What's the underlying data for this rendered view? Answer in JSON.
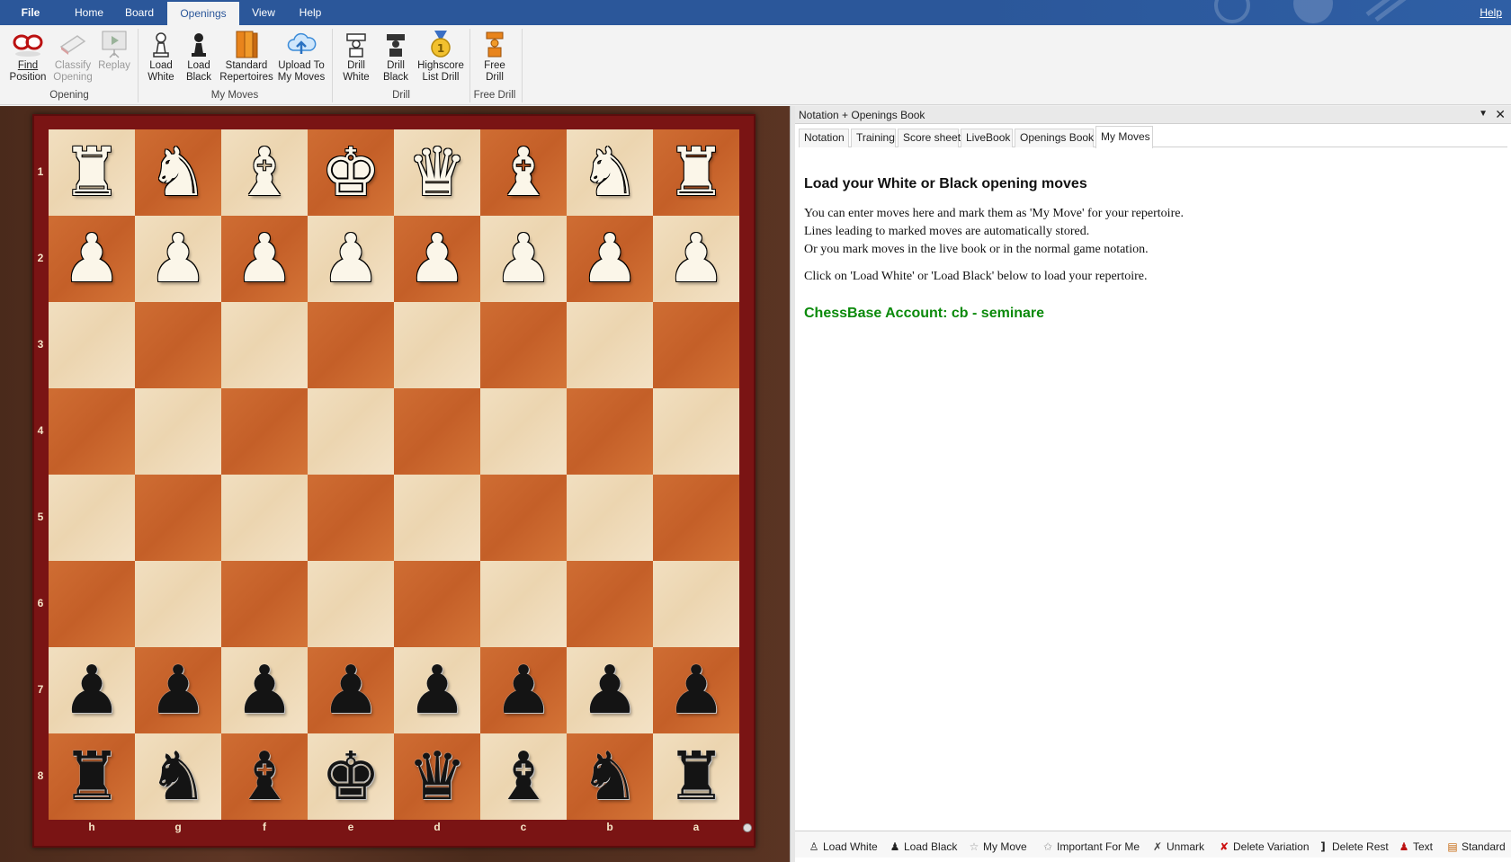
{
  "ribbon_tabs": [
    {
      "label": "File"
    },
    {
      "label": "Home"
    },
    {
      "label": "Board"
    },
    {
      "label": "Openings",
      "active": true
    },
    {
      "label": "View"
    },
    {
      "label": "Help"
    }
  ],
  "help_link": "Help",
  "ribbon": {
    "buttons": [
      {
        "label1": "Find",
        "label2": "Position",
        "icon": "find-position-icon"
      },
      {
        "label1": "Classify",
        "label2": "Opening",
        "icon": "classify-opening-icon",
        "disabled": true
      },
      {
        "label1": "Replay",
        "label2": "",
        "icon": "replay-icon",
        "disabled": true
      },
      {
        "label1": "Load",
        "label2": "White",
        "icon": "white-pawn-icon"
      },
      {
        "label1": "Load",
        "label2": "Black",
        "icon": "black-pawn-icon"
      },
      {
        "label1": "Standard",
        "label2": "Repertoires",
        "icon": "books-icon"
      },
      {
        "label1": "Upload To",
        "label2": "My Moves",
        "icon": "cloud-upload-icon"
      },
      {
        "label1": "Drill",
        "label2": "White",
        "icon": "drill-white-icon"
      },
      {
        "label1": "Drill",
        "label2": "Black",
        "icon": "drill-black-icon"
      },
      {
        "label1": "Highscore",
        "label2": "List Drill",
        "icon": "medal-icon"
      },
      {
        "label1": "Free",
        "label2": "Drill",
        "icon": "free-drill-icon"
      }
    ],
    "groups": [
      "Opening",
      "My Moves",
      "Drill",
      "Free Drill"
    ]
  },
  "board": {
    "ranks": [
      "1",
      "2",
      "3",
      "4",
      "5",
      "6",
      "7",
      "8"
    ],
    "files": [
      "h",
      "g",
      "f",
      "e",
      "d",
      "c",
      "b",
      "a"
    ],
    "rows": [
      [
        "wR",
        "wN",
        "wB",
        "wK",
        "wQ",
        "wB",
        "wN",
        "wR"
      ],
      [
        "wP",
        "wP",
        "wP",
        "wP",
        "wP",
        "wP",
        "wP",
        "wP"
      ],
      [
        "",
        "",
        "",
        "",
        "",
        "",
        "",
        ""
      ],
      [
        "",
        "",
        "",
        "",
        "",
        "",
        "",
        ""
      ],
      [
        "",
        "",
        "",
        "",
        "",
        "",
        "",
        ""
      ],
      [
        "",
        "",
        "",
        "",
        "",
        "",
        "",
        ""
      ],
      [
        "bP",
        "bP",
        "bP",
        "bP",
        "bP",
        "bP",
        "bP",
        "bP"
      ],
      [
        "bR",
        "bN",
        "bB",
        "bK",
        "bQ",
        "bB",
        "bN",
        "bR"
      ]
    ]
  },
  "pane": {
    "title": "Notation + Openings Book",
    "tabs": [
      {
        "label": "Notation"
      },
      {
        "label": "Training"
      },
      {
        "label": "Score sheet"
      },
      {
        "label": "LiveBook"
      },
      {
        "label": "Openings Book"
      },
      {
        "label": "My Moves",
        "active": true
      }
    ],
    "heading": "Load your White or Black opening moves",
    "lines": [
      "You can enter moves here and mark them as 'My Move' for your repertoire.",
      "Lines leading to marked moves are automatically stored.",
      "Or you mark moves in the live book or in the normal game notation."
    ],
    "instruction": "Click on 'Load White' or 'Load Black' below to load your repertoire.",
    "account": "ChessBase Account: cb - seminare"
  },
  "bottom_toolbar": [
    {
      "label": "Load White",
      "icon": "white-pawn-icon"
    },
    {
      "label": "Load Black",
      "icon": "black-pawn-icon"
    },
    {
      "label": "My Move",
      "icon": "star-icon"
    },
    {
      "label": "Important For Me",
      "icon": "star-plus-icon"
    },
    {
      "label": "Unmark",
      "icon": "unmark-icon"
    },
    {
      "label": "Delete Variation",
      "icon": "delete-variation-icon"
    },
    {
      "label": "Delete Rest",
      "icon": "bracket-icon"
    },
    {
      "label": "Text",
      "icon": "text-pawn-icon"
    },
    {
      "label": "Standard",
      "icon": "books-icon"
    }
  ],
  "colors": {
    "accent": "#2b579a",
    "account_green": "#0b8a0b",
    "board_light": "#ecd5b0",
    "board_dark": "#c45f28"
  }
}
